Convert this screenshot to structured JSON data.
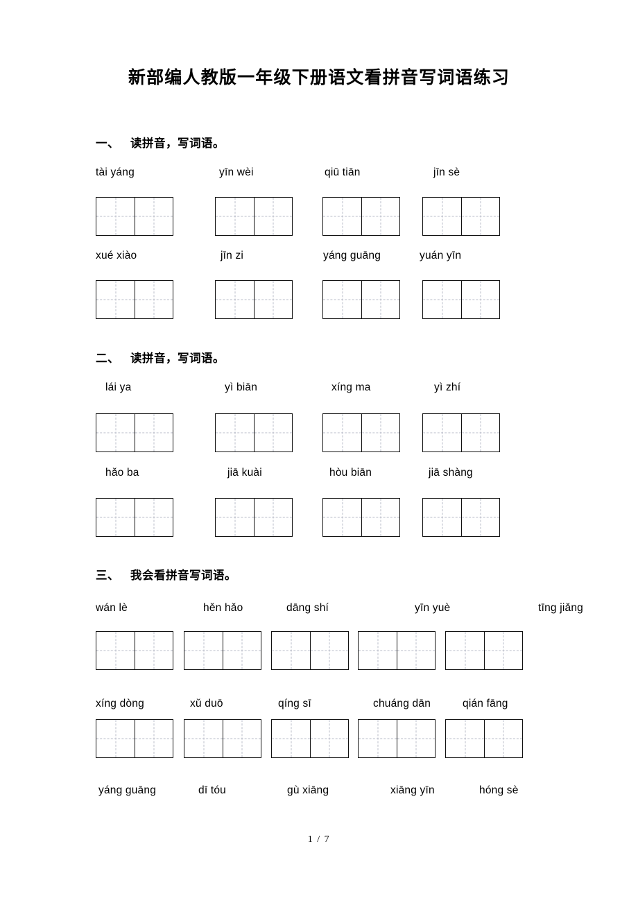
{
  "document": {
    "title": "新部编人教版一年级下册语文看拼音写词语练习",
    "footer": "1 / 7"
  },
  "sections": [
    {
      "number": "一、",
      "heading": "读拼音，写词语。",
      "cells_per_box": 2,
      "rows": [
        {
          "groups": [
            {
              "pinyin": "tài  yáng",
              "syllables": [
                "tài",
                "yáng"
              ]
            },
            {
              "pinyin": "yīn  wèi",
              "syllables": [
                "yīn",
                "wèi"
              ]
            },
            {
              "pinyin": "qiū  tiān",
              "syllables": [
                "qiū",
                "tiān"
              ]
            },
            {
              "pinyin": "jīn  sè",
              "syllables": [
                "jīn",
                "sè"
              ]
            }
          ]
        },
        {
          "groups": [
            {
              "pinyin": "xué   xiào",
              "syllables": [
                "xué",
                "xiào"
              ]
            },
            {
              "pinyin": "jīn  zi",
              "syllables": [
                "jīn",
                "zi"
              ]
            },
            {
              "pinyin": "yáng guāng",
              "syllables": [
                "yáng",
                "guāng"
              ]
            },
            {
              "pinyin": "yuán yīn",
              "syllables": [
                "yuán",
                "yīn"
              ]
            }
          ]
        }
      ]
    },
    {
      "number": "二、",
      "heading": "读拼音，写词语。",
      "cells_per_box": 2,
      "rows": [
        {
          "groups": [
            {
              "pinyin": "lái  ya",
              "syllables": [
                "lái",
                "ya"
              ]
            },
            {
              "pinyin": "yì   biān",
              "syllables": [
                "yì",
                "biān"
              ]
            },
            {
              "pinyin": "xíng ma",
              "syllables": [
                "xíng",
                "ma"
              ]
            },
            {
              "pinyin": "yì    zhí",
              "syllables": [
                "yì",
                "zhí"
              ]
            }
          ]
        },
        {
          "groups": [
            {
              "pinyin": "hǎo  ba",
              "syllables": [
                "hǎo",
                "ba"
              ]
            },
            {
              "pinyin": "jiā kuài",
              "syllables": [
                "jiā",
                "kuài"
              ]
            },
            {
              "pinyin": "hòu  biān",
              "syllables": [
                "hòu",
                "biān"
              ]
            },
            {
              "pinyin": "jiā   shàng",
              "syllables": [
                "jiā",
                "shàng"
              ]
            }
          ]
        }
      ]
    },
    {
      "number": "三、",
      "heading": "我会看拼音写词语。",
      "cells_per_box": 2,
      "rows": [
        {
          "groups": [
            {
              "pinyin": "wán    lè",
              "syllables": [
                "wán",
                "lè"
              ]
            },
            {
              "pinyin": "hěn  hǎo",
              "syllables": [
                "hěn",
                "hǎo"
              ]
            },
            {
              "pinyin": "dāng shí",
              "syllables": [
                "dāng",
                "shí"
              ]
            },
            {
              "pinyin": "yīn  yuè",
              "syllables": [
                "yīn",
                "yuè"
              ]
            },
            {
              "pinyin": "tīng jiǎng",
              "syllables": [
                "tīng",
                "jiǎng"
              ]
            }
          ]
        },
        {
          "groups": [
            {
              "pinyin": "xíng  dòng",
              "syllables": [
                "xíng",
                "dòng"
              ]
            },
            {
              "pinyin": "xǔ     duō",
              "syllables": [
                "xǔ",
                "duō"
              ]
            },
            {
              "pinyin": "qíng  sī",
              "syllables": [
                "qíng",
                "sī"
              ]
            },
            {
              "pinyin": "chuáng dān",
              "syllables": [
                "chuáng",
                "dān"
              ]
            },
            {
              "pinyin": "qián  fāng",
              "syllables": [
                "qián",
                "fāng"
              ]
            }
          ]
        },
        {
          "groups": [
            {
              "pinyin": "yáng guāng",
              "syllables": [
                "yáng",
                "guāng"
              ]
            },
            {
              "pinyin": "dī     tóu",
              "syllables": [
                "dī",
                "tóu"
              ]
            },
            {
              "pinyin": "gù   xiāng",
              "syllables": [
                "gù",
                "xiāng"
              ]
            },
            {
              "pinyin": "xiāng yīn",
              "syllables": [
                "xiāng",
                "yīn"
              ]
            },
            {
              "pinyin": "hóng  sè",
              "syllables": [
                "hóng",
                "sè"
              ]
            }
          ]
        }
      ]
    }
  ]
}
